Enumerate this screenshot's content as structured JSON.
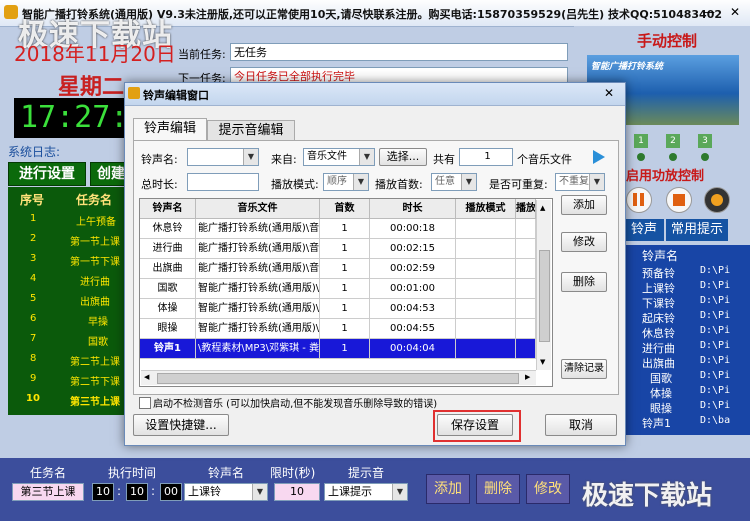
{
  "app": {
    "title": "智能广播打铃系统(通用版) V9.3未注册版,还可以正常使用10天,请尽快联系注册。购买电话:15870359529(吕先生) 技术QQ:510483402",
    "minimize": "—",
    "close": "✕",
    "watermark_top": "极速下载站",
    "watermark_bottom": "极速下载站"
  },
  "clock": {
    "date": "2018年11月20日",
    "weekday": "星期二",
    "time": "17:27:5"
  },
  "system_log_label": "系统日志:",
  "left_buttons": {
    "settings": "进行设置",
    "create": "创建"
  },
  "task_list": {
    "headers": [
      "序号",
      "任务名"
    ],
    "rows": [
      {
        "no": "1",
        "name": "上午预备"
      },
      {
        "no": "2",
        "name": "第一节上课"
      },
      {
        "no": "3",
        "name": "第一节下课"
      },
      {
        "no": "4",
        "name": "进行曲"
      },
      {
        "no": "5",
        "name": "出旗曲"
      },
      {
        "no": "6",
        "name": "早操"
      },
      {
        "no": "7",
        "name": "国歌"
      },
      {
        "no": "8",
        "name": "第二节上课"
      },
      {
        "no": "9",
        "name": "第二节下课"
      },
      {
        "no": "10",
        "name": "第三节上课"
      }
    ]
  },
  "task_info": {
    "current_label": "当前任务:",
    "current_value": "无任务",
    "next_label": "下一任务:",
    "next_value": "今日任务已全部执行完毕"
  },
  "right_panel": {
    "manual_title": "手动控制",
    "banner_text": "智能广播打铃系统",
    "numbers": [
      "1",
      "2",
      "3"
    ],
    "power_label": "启用功放控制",
    "tabs": [
      "铃声",
      "常用提示"
    ],
    "list_header": "铃声名",
    "items": [
      {
        "name": "预备铃",
        "path": "D:\\Pi"
      },
      {
        "name": "上课铃",
        "path": "D:\\Pi"
      },
      {
        "name": "下课铃",
        "path": "D:\\Pi"
      },
      {
        "name": "起床铃",
        "path": "D:\\Pi"
      },
      {
        "name": "休息铃",
        "path": "D:\\Pi"
      },
      {
        "name": "进行曲",
        "path": "D:\\Pi"
      },
      {
        "name": "出旗曲",
        "path": "D:\\Pi"
      },
      {
        "name": "国歌",
        "path": "D:\\Pi"
      },
      {
        "name": "体操",
        "path": "D:\\Pi"
      },
      {
        "name": "眼操",
        "path": "D:\\Pi"
      },
      {
        "name": "铃声1",
        "path": "D:\\ba"
      }
    ]
  },
  "bottom_bar": {
    "labels": {
      "task": "任务名",
      "time": "执行时间",
      "ring": "铃声名",
      "limit": "限时(秒)",
      "prompt": "提示音"
    },
    "task_value": "第三节上课",
    "hour": "10",
    "minute": "10",
    "second": "00",
    "ring_value": "上课铃",
    "limit_value": "10",
    "prompt_value": "上课提示",
    "buttons": {
      "add": "添加",
      "delete": "删除",
      "modify": "修改"
    }
  },
  "dialog": {
    "title": "铃声编辑窗口",
    "close": "✕",
    "tabs": [
      "铃声编辑",
      "提示音编辑"
    ],
    "form": {
      "ring_name_label": "铃声名:",
      "ring_name_value": "",
      "source_label": "来自:",
      "source_value": "音乐文件",
      "choose_button": "选择...",
      "total_label": "共有",
      "total_value": "1",
      "total_unit": "个音乐文件",
      "duration_label": "总时长:",
      "duration_value": "",
      "play_mode_label": "播放模式:",
      "play_mode_value": "顺序",
      "play_count_label": "播放首数:",
      "play_count_value": "任意",
      "repeat_label": "是否可重复:",
      "repeat_value": "不重复"
    },
    "table": {
      "headers": [
        "铃声名",
        "音乐文件",
        "首数",
        "时长",
        "播放模式",
        "播放"
      ],
      "rows": [
        {
          "name": "休息铃",
          "file": "能广播打铃系统(通用版)\\音",
          "count": "1",
          "duration": "00:00:18",
          "mode": "",
          "extra": ""
        },
        {
          "name": "进行曲",
          "file": "能广播打铃系统(通用版)\\音",
          "count": "1",
          "duration": "00:02:15",
          "mode": "",
          "extra": ""
        },
        {
          "name": "出旗曲",
          "file": "能广播打铃系统(通用版)\\音",
          "count": "1",
          "duration": "00:02:59",
          "mode": "",
          "extra": ""
        },
        {
          "name": "国歌",
          "file": "智能广播打铃系统(通用版)\\",
          "count": "1",
          "duration": "00:01:00",
          "mode": "",
          "extra": ""
        },
        {
          "name": "体操",
          "file": "智能广播打铃系统(通用版)\\",
          "count": "1",
          "duration": "00:04:53",
          "mode": "",
          "extra": ""
        },
        {
          "name": "眼操",
          "file": "智能广播打铃系统(通用版)\\",
          "count": "1",
          "duration": "00:04:55",
          "mode": "",
          "extra": ""
        },
        {
          "name": "铃声1",
          "file": "\\教程素材\\MP3\\邓紫琪 - 粪",
          "count": "1",
          "duration": "00:04:04",
          "mode": "",
          "extra": ""
        }
      ],
      "selected_index": 6
    },
    "side_buttons": {
      "add": "添加",
      "modify": "修改",
      "delete": "删除",
      "clear": "清除记录"
    },
    "checkbox_label": "启动不检测音乐 (可以加快启动,但不能发现音乐删除导致的错误)",
    "shortcut_button": "设置快捷键...",
    "save_button": "保存设置",
    "cancel_button": "取消"
  }
}
